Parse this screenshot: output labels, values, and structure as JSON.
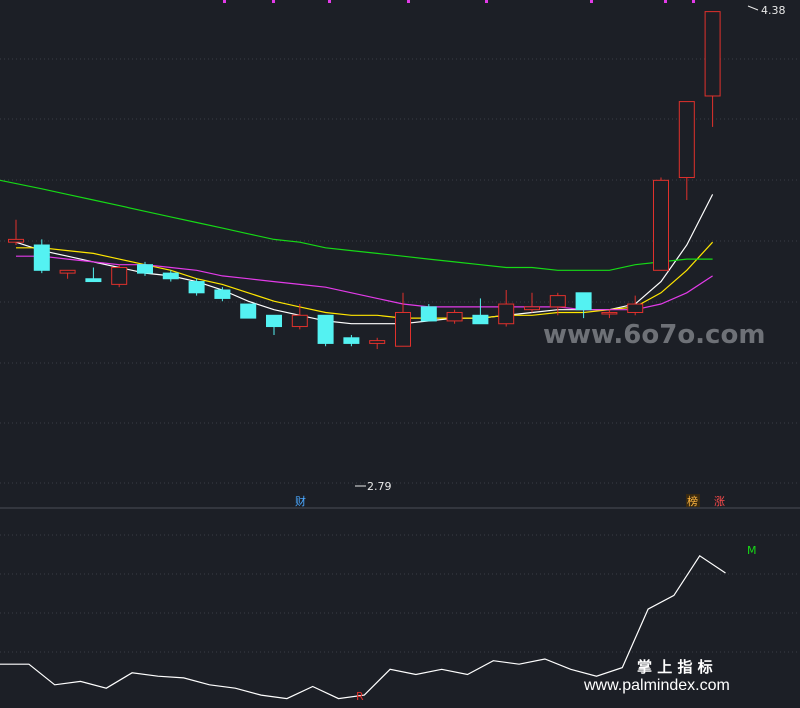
{
  "chart_data": {
    "type": "candlestick",
    "colors": {
      "background": "#1c1f26",
      "grid": "#3a3d46",
      "up": "#e0312c",
      "down": "#54f2f2",
      "ma_white": "#ffffff",
      "ma_yellow": "#ffe600",
      "ma_magenta": "#e23be8",
      "ma_green": "#16d916",
      "indicator": "#ffffff",
      "marker": "#e23be8"
    },
    "price_range": [
      2.7,
      4.4
    ],
    "candles": [
      {
        "o": 3.56,
        "c": 3.57,
        "h": 3.64,
        "l": 3.55
      },
      {
        "o": 3.55,
        "c": 3.46,
        "h": 3.57,
        "l": 3.45
      },
      {
        "o": 3.45,
        "c": 3.46,
        "h": 3.46,
        "l": 3.43
      },
      {
        "o": 3.43,
        "c": 3.42,
        "h": 3.47,
        "l": 3.42
      },
      {
        "o": 3.41,
        "c": 3.47,
        "h": 3.48,
        "l": 3.4
      },
      {
        "o": 3.48,
        "c": 3.45,
        "h": 3.49,
        "l": 3.44
      },
      {
        "o": 3.45,
        "c": 3.43,
        "h": 3.46,
        "l": 3.42
      },
      {
        "o": 3.42,
        "c": 3.38,
        "h": 3.43,
        "l": 3.37
      },
      {
        "o": 3.39,
        "c": 3.36,
        "h": 3.4,
        "l": 3.35
      },
      {
        "o": 3.34,
        "c": 3.29,
        "h": 3.34,
        "l": 3.29
      },
      {
        "o": 3.3,
        "c": 3.26,
        "h": 3.3,
        "l": 3.23
      },
      {
        "o": 3.26,
        "c": 3.3,
        "h": 3.34,
        "l": 3.25
      },
      {
        "o": 3.3,
        "c": 3.2,
        "h": 3.3,
        "l": 3.19
      },
      {
        "o": 3.22,
        "c": 3.2,
        "h": 3.23,
        "l": 3.19
      },
      {
        "o": 3.2,
        "c": 3.21,
        "h": 3.22,
        "l": 3.18
      },
      {
        "o": 3.19,
        "c": 3.31,
        "h": 3.38,
        "l": 3.19
      },
      {
        "o": 3.33,
        "c": 3.28,
        "h": 3.34,
        "l": 3.28
      },
      {
        "o": 3.28,
        "c": 3.31,
        "h": 3.32,
        "l": 3.27
      },
      {
        "o": 3.3,
        "c": 3.27,
        "h": 3.36,
        "l": 3.27
      },
      {
        "o": 3.27,
        "c": 3.34,
        "h": 3.39,
        "l": 3.26
      },
      {
        "o": 3.32,
        "c": 3.33,
        "h": 3.38,
        "l": 3.31
      },
      {
        "o": 3.33,
        "c": 3.37,
        "h": 3.38,
        "l": 3.3
      },
      {
        "o": 3.38,
        "c": 3.32,
        "h": 3.38,
        "l": 3.29
      },
      {
        "o": 3.31,
        "c": 3.31,
        "h": 3.32,
        "l": 3.29
      },
      {
        "o": 3.31,
        "c": 3.34,
        "h": 3.37,
        "l": 3.3
      },
      {
        "o": 3.46,
        "c": 3.78,
        "h": 3.79,
        "l": 3.57
      },
      {
        "o": 3.79,
        "c": 4.06,
        "h": 4.06,
        "l": 3.71
      },
      {
        "o": 4.08,
        "c": 4.38,
        "h": 4.38,
        "l": 3.97
      }
    ],
    "moving_averages": [
      {
        "color_key": "ma_white",
        "values": [
          3.56,
          3.53,
          3.51,
          3.49,
          3.47,
          3.45,
          3.44,
          3.42,
          3.39,
          3.35,
          3.32,
          3.3,
          3.28,
          3.27,
          3.27,
          3.27,
          3.28,
          3.29,
          3.29,
          3.3,
          3.31,
          3.32,
          3.32,
          3.32,
          3.34,
          3.42,
          3.55,
          3.73
        ]
      },
      {
        "color_key": "ma_yellow",
        "values": [
          3.54,
          3.54,
          3.53,
          3.52,
          3.5,
          3.48,
          3.46,
          3.43,
          3.41,
          3.38,
          3.35,
          3.33,
          3.31,
          3.3,
          3.3,
          3.29,
          3.29,
          3.29,
          3.29,
          3.3,
          3.3,
          3.31,
          3.31,
          3.32,
          3.33,
          3.38,
          3.46,
          3.56
        ]
      },
      {
        "color_key": "ma_magenta",
        "values": [
          3.51,
          3.51,
          3.5,
          3.49,
          3.48,
          3.48,
          3.47,
          3.46,
          3.44,
          3.43,
          3.42,
          3.41,
          3.4,
          3.38,
          3.36,
          3.34,
          3.33,
          3.33,
          3.33,
          3.33,
          3.33,
          3.33,
          3.32,
          3.32,
          3.32,
          3.34,
          3.38,
          3.44
        ]
      },
      {
        "color_key": "ma_green",
        "values": [
          3.78,
          3.75,
          3.73,
          3.71,
          3.69,
          3.67,
          3.65,
          3.63,
          3.61,
          3.59,
          3.57,
          3.56,
          3.54,
          3.53,
          3.52,
          3.51,
          3.5,
          3.49,
          3.48,
          3.47,
          3.47,
          3.46,
          3.46,
          3.46,
          3.48,
          3.49,
          3.5,
          3.5
        ]
      }
    ],
    "annotations": {
      "high_label": "4.38",
      "low_label": "2.79",
      "tag_cai": "财",
      "tag_bang": "榜",
      "tag_zhang": "涨",
      "mark_r": "R",
      "mark_m": "M"
    },
    "indicator": {
      "values": [
        0.22,
        0.22,
        0.1,
        0.12,
        0.08,
        0.17,
        0.15,
        0.14,
        0.1,
        0.08,
        0.04,
        0.02,
        0.09,
        0.02,
        0.04,
        0.19,
        0.16,
        0.19,
        0.16,
        0.24,
        0.22,
        0.25,
        0.19,
        0.15,
        0.2,
        0.54,
        0.62,
        0.85,
        0.75
      ],
      "range": [
        0.0,
        1.0
      ]
    }
  },
  "watermark": {
    "site_text": "www.6o7o.com",
    "brand_cn": "掌 上 指 标",
    "brand_url": "www.palmindex.com"
  }
}
